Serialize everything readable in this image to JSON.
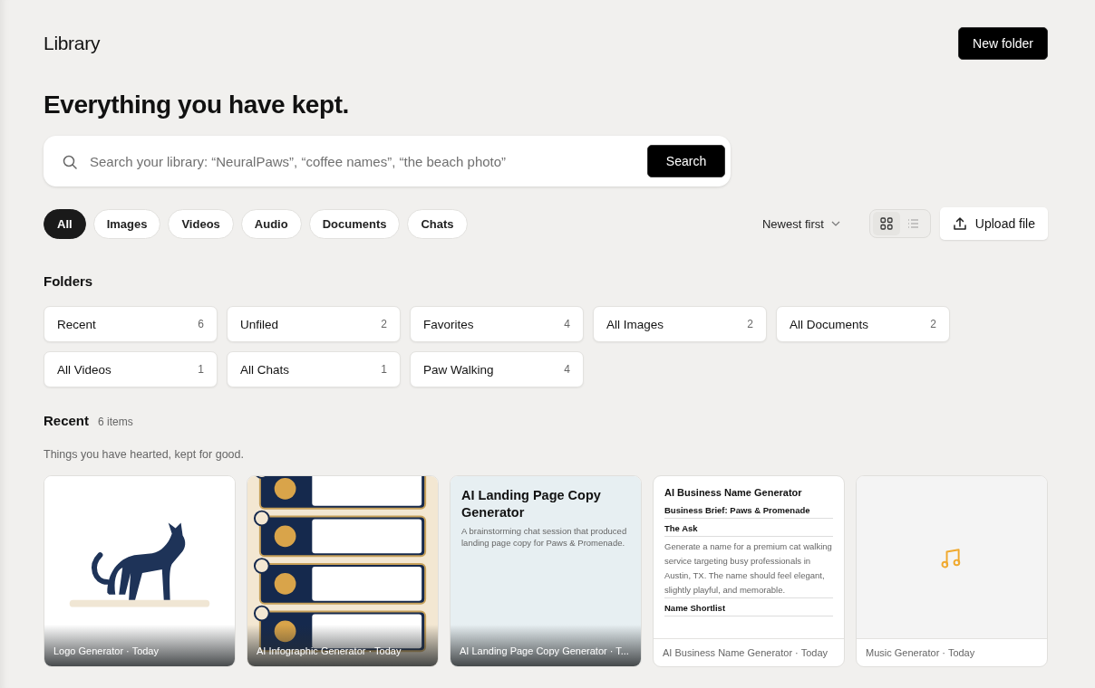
{
  "header": {
    "title": "Library",
    "new_folder": "New folder"
  },
  "headline": "Everything you have kept.",
  "search": {
    "placeholder": "Search your library: “NeuralPaws”, “coffee names”, “the beach photo”",
    "button": "Search"
  },
  "filters": [
    {
      "label": "All",
      "selected": true
    },
    {
      "label": "Images",
      "selected": false
    },
    {
      "label": "Videos",
      "selected": false
    },
    {
      "label": "Audio",
      "selected": false
    },
    {
      "label": "Documents",
      "selected": false
    },
    {
      "label": "Chats",
      "selected": false
    }
  ],
  "sort": {
    "label": "Newest first"
  },
  "view_modes": [
    {
      "kind": "grid",
      "selected": true
    },
    {
      "kind": "list",
      "selected": false
    }
  ],
  "upload": "Upload file",
  "folders_title": "Folders",
  "folders": [
    {
      "name": "Recent",
      "count": "6"
    },
    {
      "name": "Unfiled",
      "count": "2"
    },
    {
      "name": "Favorites",
      "count": "4"
    },
    {
      "name": "All Images",
      "count": "2"
    },
    {
      "name": "All Documents",
      "count": "2"
    },
    {
      "name": "All Videos",
      "count": "1"
    },
    {
      "name": "All Chats",
      "count": "1"
    },
    {
      "name": "Paw Walking",
      "count": "4"
    }
  ],
  "section": {
    "title": "Recent",
    "count": "6 items",
    "subtitle": "Things you have hearted, kept for good."
  },
  "items": [
    {
      "kind": "logo",
      "caption": "Logo Generator · Today"
    },
    {
      "kind": "infographic",
      "caption": "AI Infographic Generator · Today"
    },
    {
      "kind": "chat",
      "title": "AI Landing Page Copy Generator",
      "description": "A brainstorming chat session that produced landing page copy for Paws & Promenade.",
      "caption": "AI Landing Page Copy Generator · T..."
    },
    {
      "kind": "document",
      "title": "AI Business Name Generator",
      "lines": [
        {
          "kind": "heading",
          "text": "Business Brief: Paws & Promenade"
        },
        {
          "kind": "heading",
          "text": "The Ask"
        },
        {
          "kind": "body",
          "text": "Generate a name for a premium cat walking service targeting busy professionals in Austin, TX. The name should feel elegant, slightly playful, and memorable."
        },
        {
          "kind": "heading",
          "text": "Name Shortlist"
        }
      ],
      "caption": "AI Business Name Generator · Today"
    },
    {
      "kind": "audio",
      "caption": "Music Generator · Today"
    }
  ]
}
